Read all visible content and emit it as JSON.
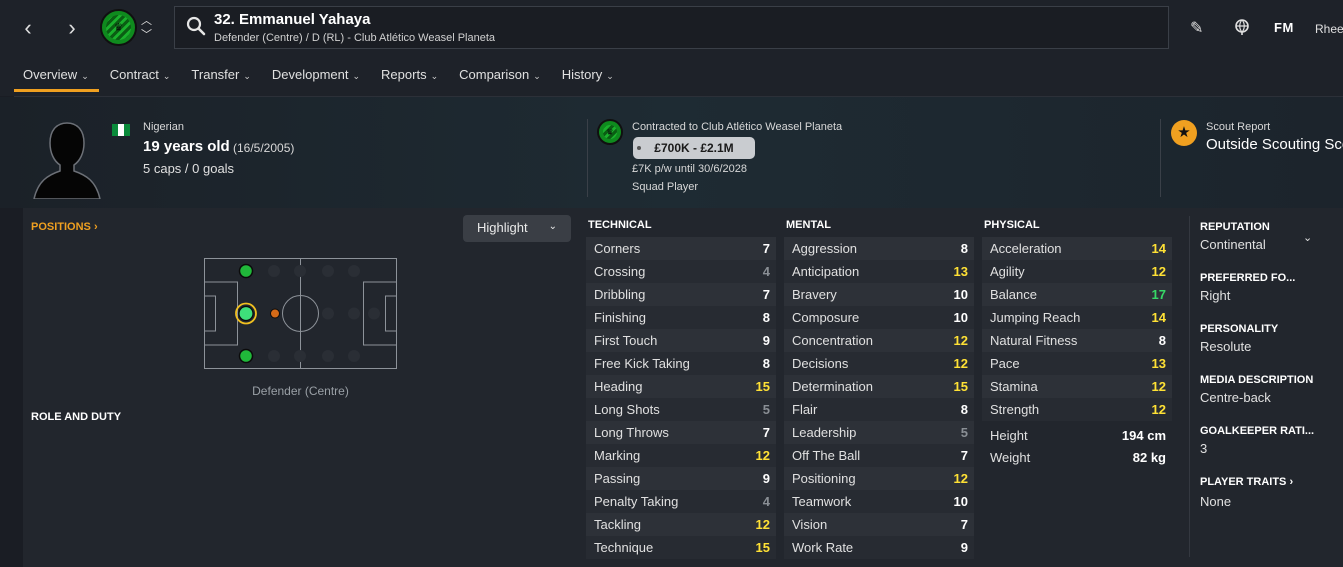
{
  "colors": {
    "accent_orange": "#f0a020",
    "attr_low": "#8a8f95",
    "attr_mid": "#ffffff",
    "attr_high": "#ffe135",
    "attr_top": "#37d867",
    "club_green": "#0f8a1e"
  },
  "topbar": {
    "back_icon": "chevron-left-icon",
    "forward_icon": "chevron-right-icon",
    "search": {
      "title": "32. Emmanuel Yahaya",
      "subtitle": "Defender (Centre) / D (RL) - Club Atlético Weasel Planeta"
    },
    "logo": "FM",
    "user": "Rheeboo"
  },
  "tabs": [
    {
      "label": "Overview",
      "active": true
    },
    {
      "label": "Contract",
      "active": false
    },
    {
      "label": "Transfer",
      "active": false
    },
    {
      "label": "Development",
      "active": false
    },
    {
      "label": "Reports",
      "active": false
    },
    {
      "label": "Comparison",
      "active": false
    },
    {
      "label": "History",
      "active": false
    }
  ],
  "header": {
    "nationality": "Nigerian",
    "age": "19 years old",
    "dob": "(16/5/2005)",
    "caps": "5 caps / 0 goals",
    "contract_club": "Contracted to Club Atlético Weasel Planeta",
    "value": "£700K - £2.1M",
    "wage": "£7K p/w until 30/6/2028",
    "squad_status": "Squad Player",
    "scout_title": "Scout Report",
    "scout_value": "Outside Scouting Scope"
  },
  "positions": {
    "link": "POSITIONS",
    "highlight": "Highlight",
    "label": "Defender (Centre)",
    "role_duty": "ROLE AND DUTY"
  },
  "attributes": {
    "technical": {
      "title": "TECHNICAL",
      "rows": [
        {
          "name": "Corners",
          "value": 7
        },
        {
          "name": "Crossing",
          "value": 4
        },
        {
          "name": "Dribbling",
          "value": 7
        },
        {
          "name": "Finishing",
          "value": 8
        },
        {
          "name": "First Touch",
          "value": 9
        },
        {
          "name": "Free Kick Taking",
          "value": 8
        },
        {
          "name": "Heading",
          "value": 15
        },
        {
          "name": "Long Shots",
          "value": 5
        },
        {
          "name": "Long Throws",
          "value": 7
        },
        {
          "name": "Marking",
          "value": 12
        },
        {
          "name": "Passing",
          "value": 9
        },
        {
          "name": "Penalty Taking",
          "value": 4
        },
        {
          "name": "Tackling",
          "value": 12
        },
        {
          "name": "Technique",
          "value": 15
        }
      ]
    },
    "mental": {
      "title": "MENTAL",
      "rows": [
        {
          "name": "Aggression",
          "value": 8
        },
        {
          "name": "Anticipation",
          "value": 13
        },
        {
          "name": "Bravery",
          "value": 10
        },
        {
          "name": "Composure",
          "value": 10
        },
        {
          "name": "Concentration",
          "value": 12
        },
        {
          "name": "Decisions",
          "value": 12
        },
        {
          "name": "Determination",
          "value": 15
        },
        {
          "name": "Flair",
          "value": 8
        },
        {
          "name": "Leadership",
          "value": 5
        },
        {
          "name": "Off The Ball",
          "value": 7
        },
        {
          "name": "Positioning",
          "value": 12
        },
        {
          "name": "Teamwork",
          "value": 10
        },
        {
          "name": "Vision",
          "value": 7
        },
        {
          "name": "Work Rate",
          "value": 9
        }
      ]
    },
    "physical": {
      "title": "PHYSICAL",
      "rows": [
        {
          "name": "Acceleration",
          "value": 14
        },
        {
          "name": "Agility",
          "value": 12
        },
        {
          "name": "Balance",
          "value": 17
        },
        {
          "name": "Jumping Reach",
          "value": 14
        },
        {
          "name": "Natural Fitness",
          "value": 8
        },
        {
          "name": "Pace",
          "value": 13
        },
        {
          "name": "Stamina",
          "value": 12
        },
        {
          "name": "Strength",
          "value": 12
        }
      ],
      "extra": [
        {
          "name": "Height",
          "value": "194 cm"
        },
        {
          "name": "Weight",
          "value": "82 kg"
        }
      ]
    }
  },
  "info": {
    "reputation": {
      "title": "REPUTATION",
      "value": "Continental"
    },
    "preferred_foot": {
      "title": "PREFERRED FO...",
      "value": "Right"
    },
    "personality": {
      "title": "PERSONALITY",
      "value": "Resolute"
    },
    "media": {
      "title": "MEDIA DESCRIPTION",
      "value": "Centre-back"
    },
    "gk_rating": {
      "title": "GOALKEEPER RATI...",
      "value": "3"
    },
    "traits": {
      "title": "PLAYER TRAITS",
      "value": "None"
    }
  }
}
